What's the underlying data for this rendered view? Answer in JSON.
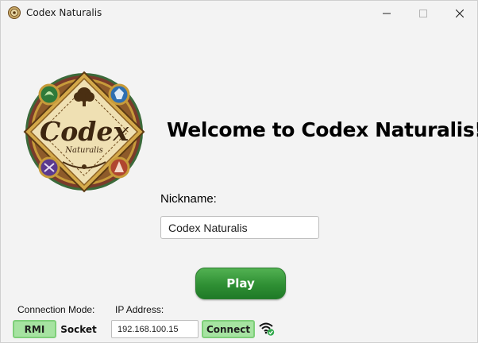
{
  "window": {
    "title": "Codex Naturalis",
    "controls": {
      "minimize": "minimize",
      "maximize": "maximize",
      "close": "close"
    }
  },
  "main": {
    "welcome_text": "Welcome to Codex Naturalis!",
    "logo": {
      "title": "Codex",
      "subtitle": "Naturalis"
    },
    "nickname": {
      "label": "Nickname:",
      "value": "Codex Naturalis"
    },
    "play_label": "Play"
  },
  "connection": {
    "mode_label": "Connection Mode:",
    "modes": [
      "RMI",
      "Socket"
    ],
    "selected_mode": "RMI",
    "ip_label": "IP Address:",
    "ip_value": "192.168.100.15",
    "connect_label": "Connect",
    "status_icon": "wifi-connected-icon"
  },
  "colors": {
    "play_green": "#2f8f34",
    "toggle_selected": "#a6e3a1",
    "window_bg": "#f0f0f0"
  }
}
